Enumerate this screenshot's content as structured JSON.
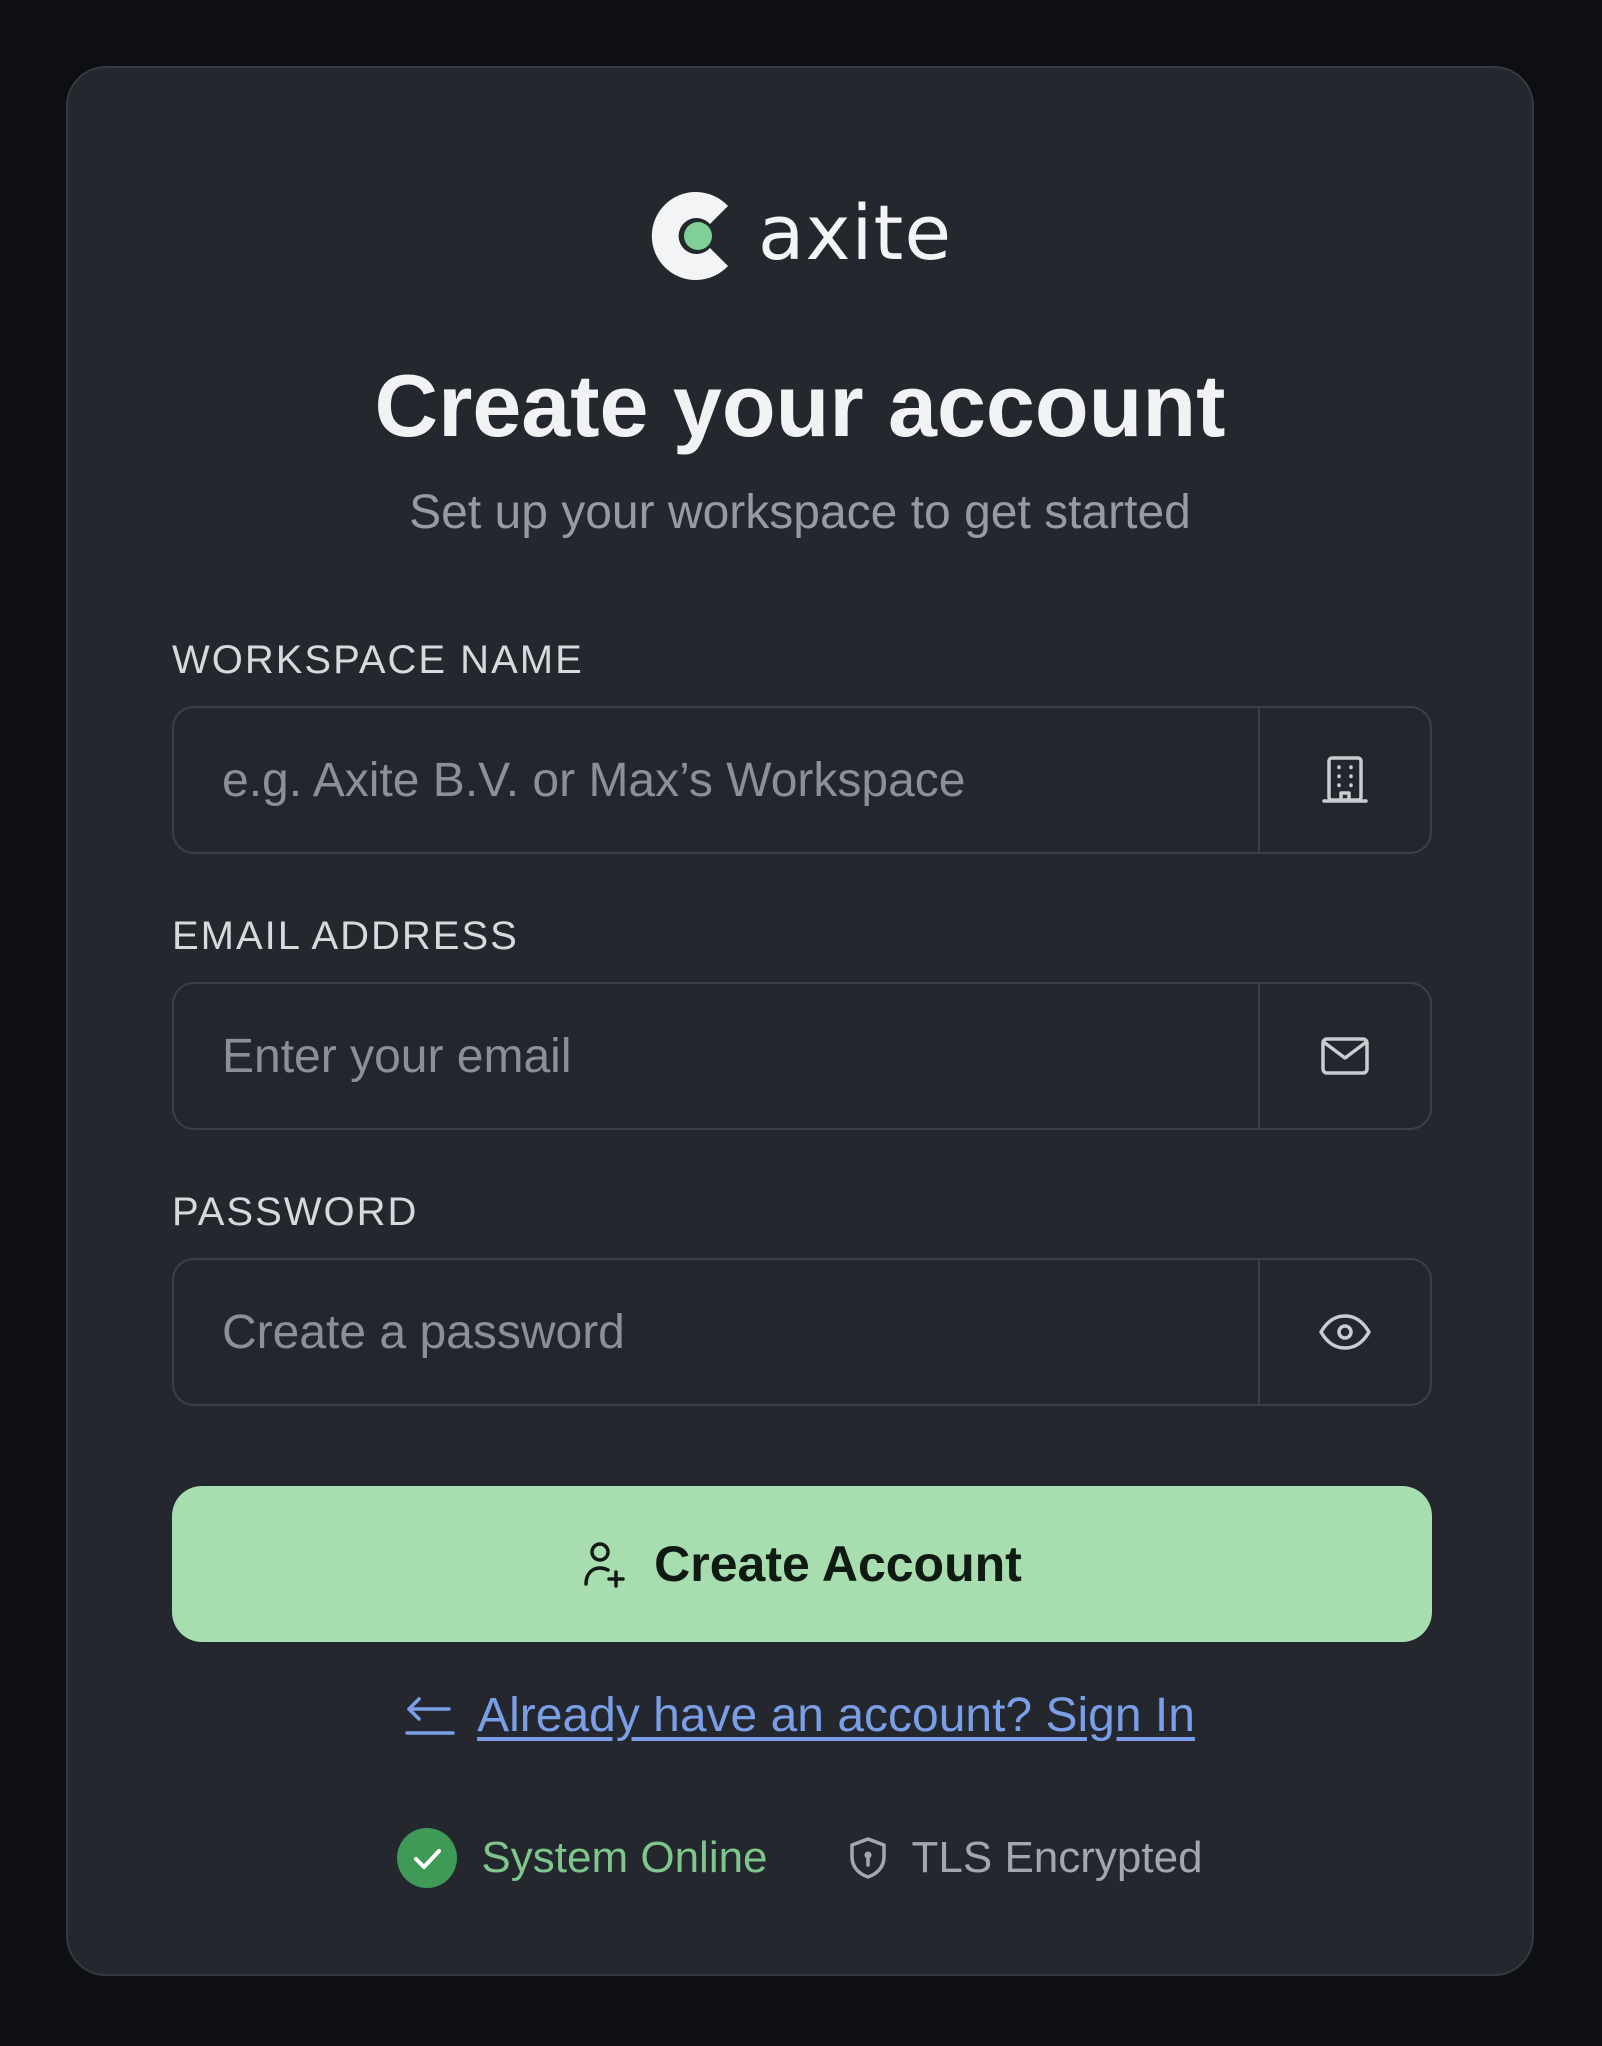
{
  "brand": {
    "name": "axite",
    "accent_color": "#7fcf96"
  },
  "header": {
    "title": "Create your account",
    "subtitle": "Set up your workspace to get started"
  },
  "form": {
    "workspace": {
      "label": "WORKSPACE NAME",
      "placeholder": "e.g. Axite B.V. or Max’s Workspace",
      "value": "",
      "icon": "building-icon"
    },
    "email": {
      "label": "EMAIL ADDRESS",
      "placeholder": "Enter your email",
      "value": "",
      "icon": "mail-icon"
    },
    "password": {
      "label": "PASSWORD",
      "placeholder": "Create a password",
      "value": "",
      "icon": "eye-icon"
    },
    "submit_label": "Create Account",
    "submit_icon": "user-plus-icon",
    "submit_color": "#a8ddb0"
  },
  "signin": {
    "label": "Already have an account? Sign In",
    "icon": "arrow-left-icon",
    "color": "#7a9fe6"
  },
  "status": {
    "online_label": "System Online",
    "online_icon": "check-circle-icon",
    "online_color": "#3f9a58",
    "tls_label": "TLS Encrypted",
    "tls_icon": "shield-icon"
  }
}
